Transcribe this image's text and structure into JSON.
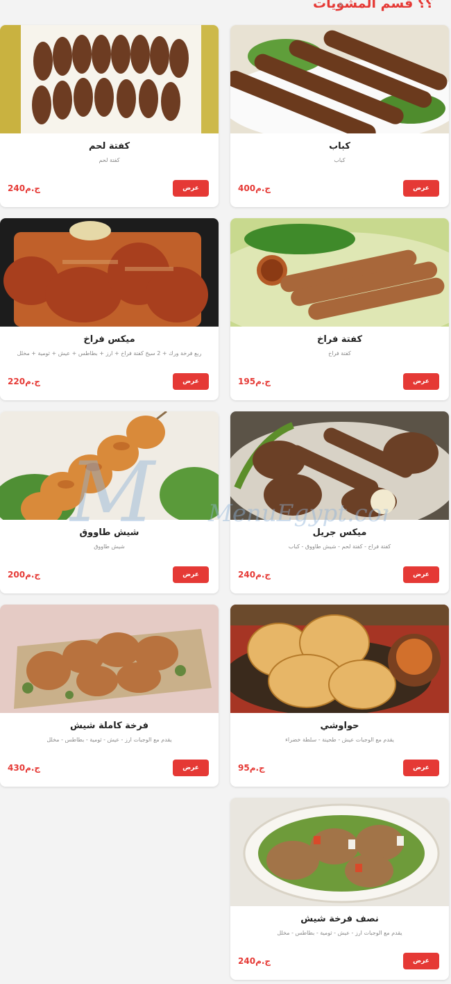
{
  "header": {
    "title": "؟؟ قسم المشويات",
    "count": "9"
  },
  "button_label": "عرض",
  "accent_color": "#e53935",
  "items": [
    {
      "name": "كباب",
      "desc": "كباب",
      "price": "ج.م400"
    },
    {
      "name": "كفتة لحم",
      "desc": "كفتة لحم",
      "price": "ج.م240"
    },
    {
      "name": "كفتة فراخ",
      "desc": "كفتة فراخ",
      "price": "ج.م195"
    },
    {
      "name": "ميكس فراخ",
      "desc": "ربع فرخة ورك + 2 سيخ كفتة فراخ + ارز + بطاطس + عيش + ثومية + مخلل",
      "price": "ج.م220"
    },
    {
      "name": "ميكس جريل",
      "desc": "كفتة فراخ - كفتة لحم - شيش طاووق - كباب",
      "price": "ج.م240"
    },
    {
      "name": "شيش طاووق",
      "desc": "شيش طاووق",
      "price": "ج.م200"
    },
    {
      "name": "حواوشي",
      "desc": "يقدم مع الوجبات عيش - طحينة - سلطة خضراء",
      "price": "ج.م95"
    },
    {
      "name": "فرخة كاملة شيش",
      "desc": "يقدم مع الوجبات ارز - عيش - ثومية - بطاطس - مخلل",
      "price": "ج.م430"
    },
    {
      "name": "نصف فرخة شيش",
      "desc": "يقدم مع الوجبات ارز - عيش - ثومية - بطاطس - مخلل",
      "price": "ج.م240"
    }
  ],
  "watermark": "MenuEgypt.com"
}
